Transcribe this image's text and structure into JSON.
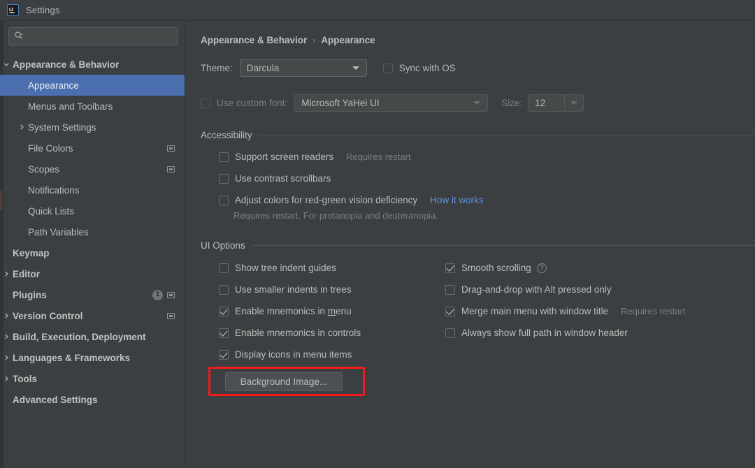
{
  "window": {
    "title": "Settings",
    "logo_icon": "intellij-idea-logo-icon"
  },
  "colors": {
    "background": "#3c3f41",
    "selection": "#4b6eaf",
    "link": "#5c91e0",
    "annotation": "#f31a1a",
    "text": "#bbbbbb",
    "muted_text": "#7b7d7e"
  },
  "sidebar": {
    "search": {
      "placeholder": "",
      "value": "",
      "icon": "search-icon"
    },
    "items": [
      {
        "label": "Appearance & Behavior",
        "level": 0,
        "twisty": "expanded",
        "bold": true,
        "selected": false,
        "badge": null,
        "config_icon": false
      },
      {
        "label": "Appearance",
        "level": 1,
        "twisty": "none",
        "bold": false,
        "selected": true,
        "badge": null,
        "config_icon": false
      },
      {
        "label": "Menus and Toolbars",
        "level": 1,
        "twisty": "none",
        "bold": false,
        "selected": false,
        "badge": null,
        "config_icon": false
      },
      {
        "label": "System Settings",
        "level": 1,
        "twisty": "collapsed",
        "bold": false,
        "selected": false,
        "badge": null,
        "config_icon": false
      },
      {
        "label": "File Colors",
        "level": 1,
        "twisty": "none",
        "bold": false,
        "selected": false,
        "badge": null,
        "config_icon": true
      },
      {
        "label": "Scopes",
        "level": 1,
        "twisty": "none",
        "bold": false,
        "selected": false,
        "badge": null,
        "config_icon": true
      },
      {
        "label": "Notifications",
        "level": 1,
        "twisty": "none",
        "bold": false,
        "selected": false,
        "badge": null,
        "config_icon": false
      },
      {
        "label": "Quick Lists",
        "level": 1,
        "twisty": "none",
        "bold": false,
        "selected": false,
        "badge": null,
        "config_icon": false
      },
      {
        "label": "Path Variables",
        "level": 1,
        "twisty": "none",
        "bold": false,
        "selected": false,
        "badge": null,
        "config_icon": false
      },
      {
        "label": "Keymap",
        "level": 0,
        "twisty": "none",
        "bold": true,
        "selected": false,
        "badge": null,
        "config_icon": false
      },
      {
        "label": "Editor",
        "level": 0,
        "twisty": "collapsed",
        "bold": true,
        "selected": false,
        "badge": null,
        "config_icon": false
      },
      {
        "label": "Plugins",
        "level": 0,
        "twisty": "none",
        "bold": true,
        "selected": false,
        "badge": "1",
        "config_icon": true
      },
      {
        "label": "Version Control",
        "level": 0,
        "twisty": "collapsed",
        "bold": true,
        "selected": false,
        "badge": null,
        "config_icon": true
      },
      {
        "label": "Build, Execution, Deployment",
        "level": 0,
        "twisty": "collapsed",
        "bold": true,
        "selected": false,
        "badge": null,
        "config_icon": false
      },
      {
        "label": "Languages & Frameworks",
        "level": 0,
        "twisty": "collapsed",
        "bold": true,
        "selected": false,
        "badge": null,
        "config_icon": false
      },
      {
        "label": "Tools",
        "level": 0,
        "twisty": "collapsed",
        "bold": true,
        "selected": false,
        "badge": null,
        "config_icon": false
      },
      {
        "label": "Advanced Settings",
        "level": 0,
        "twisty": "none",
        "bold": true,
        "selected": false,
        "badge": null,
        "config_icon": false
      }
    ]
  },
  "content": {
    "breadcrumb": {
      "parent": "Appearance & Behavior",
      "separator": "›",
      "current": "Appearance"
    },
    "theme": {
      "label": "Theme:",
      "value": "Darcula",
      "sync_with_os": {
        "label": "Sync with OS",
        "checked": false
      }
    },
    "custom_font": {
      "checkbox_label": "Use custom font:",
      "checked": false,
      "value": "Microsoft YaHei UI",
      "size_label": "Size:",
      "size_value": "12"
    },
    "accessibility": {
      "title": "Accessibility",
      "options": [
        {
          "label": "Support screen readers",
          "checked": false,
          "hint": "Requires restart",
          "link": null
        },
        {
          "label": "Use contrast scrollbars",
          "checked": false,
          "hint": null,
          "link": null
        },
        {
          "label": "Adjust colors for red-green vision deficiency",
          "checked": false,
          "hint": null,
          "link": "How it works"
        }
      ],
      "note": "Requires restart. For protanopia and deuteranopia."
    },
    "ui_options": {
      "title": "UI Options",
      "left_column": [
        {
          "label": "Show tree indent guides",
          "checked": false,
          "mnemonic": null
        },
        {
          "label": "Use smaller indents in trees",
          "checked": false,
          "mnemonic": null
        },
        {
          "label": "Enable mnemonics in menu",
          "checked": true,
          "mnemonic": "m"
        },
        {
          "label": "Enable mnemonics in controls",
          "checked": true,
          "mnemonic": null
        },
        {
          "label": "Display icons in menu items",
          "checked": true,
          "mnemonic": null
        }
      ],
      "right_column": [
        {
          "label": "Smooth scrolling",
          "checked": true,
          "hint": null,
          "help_icon": true
        },
        {
          "label": "Drag-and-drop with Alt pressed only",
          "checked": false,
          "hint": null,
          "help_icon": false
        },
        {
          "label": "Merge main menu with window title",
          "checked": true,
          "hint": "Requires restart",
          "help_icon": false
        },
        {
          "label": "Always show full path in window header",
          "checked": false,
          "hint": null,
          "help_icon": false
        }
      ],
      "background_image_button": "Background Image..."
    }
  }
}
